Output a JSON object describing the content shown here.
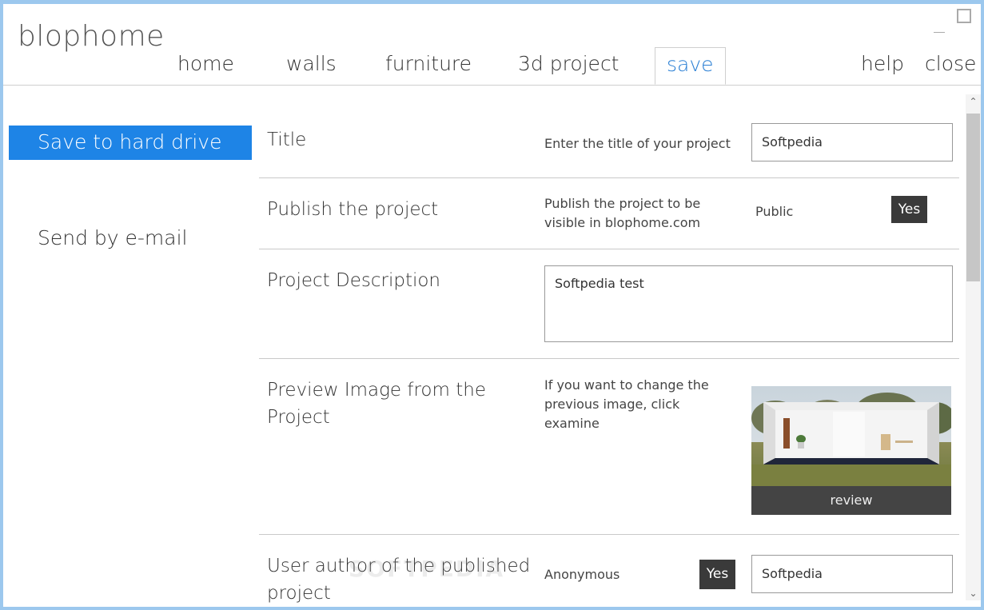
{
  "window": {
    "title": "blophome"
  },
  "nav": {
    "home": "home",
    "walls": "walls",
    "furniture": "furniture",
    "project3d": "3d project",
    "save": "save",
    "help": "help",
    "close": "close"
  },
  "sidebar": {
    "items": [
      {
        "label": "Save to hard drive",
        "active": true
      },
      {
        "label": "Send by e-mail",
        "active": false
      }
    ]
  },
  "form": {
    "title": {
      "label": "Title",
      "hint": "Enter the title of your project",
      "value": "Softpedia"
    },
    "publish": {
      "label": "Publish the project",
      "hint": "Publish the project to be visible in blophome.com",
      "visibility": "Public",
      "toggle": "Yes"
    },
    "description": {
      "label": "Project Description",
      "value": "Softpedia test"
    },
    "preview": {
      "label": "Preview Image from the Project",
      "hint": "If you want to change the previous image, click examine",
      "button": "review"
    },
    "author": {
      "label": "User author of the published project",
      "anonymous": "Anonymous",
      "toggle": "Yes",
      "value": "Softpedia"
    }
  },
  "watermark": "SOFTPEDIA",
  "colors": {
    "accent": "#1e84e6",
    "active_tab_text": "#2a7fd4",
    "window_border": "#9cc8ee",
    "dark_button": "#3a3a3a"
  }
}
